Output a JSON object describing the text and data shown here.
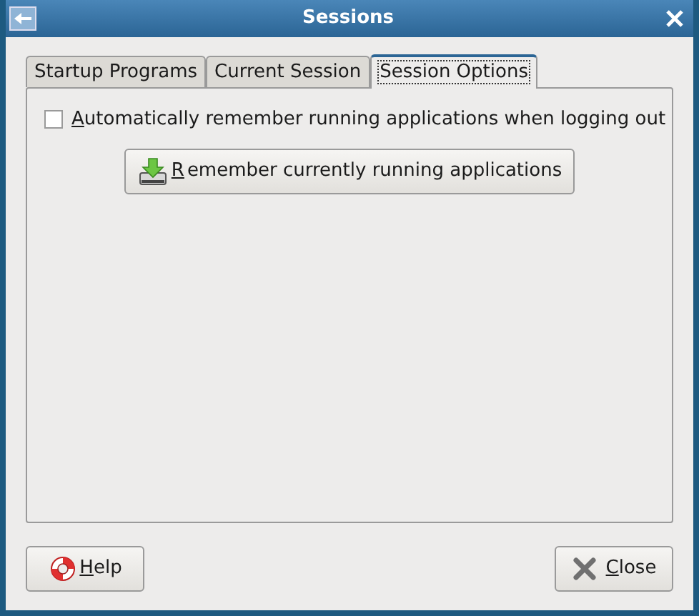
{
  "window": {
    "title": "Sessions"
  },
  "tabs": [
    {
      "label": "Startup Programs",
      "selected": false
    },
    {
      "label": "Current Session",
      "selected": false
    },
    {
      "label": "Session Options",
      "selected": true
    }
  ],
  "options": {
    "checkbox": {
      "mnemonic": "A",
      "rest": "utomatically remember running applications when logging out",
      "checked": false
    },
    "remember_button": {
      "mnemonic": "R",
      "rest": "emember currently running applications"
    }
  },
  "buttons": [
    {
      "kind": "help",
      "mnemonic": "H",
      "rest": "elp"
    },
    {
      "kind": "close",
      "mnemonic": "C",
      "rest": "lose"
    }
  ]
}
